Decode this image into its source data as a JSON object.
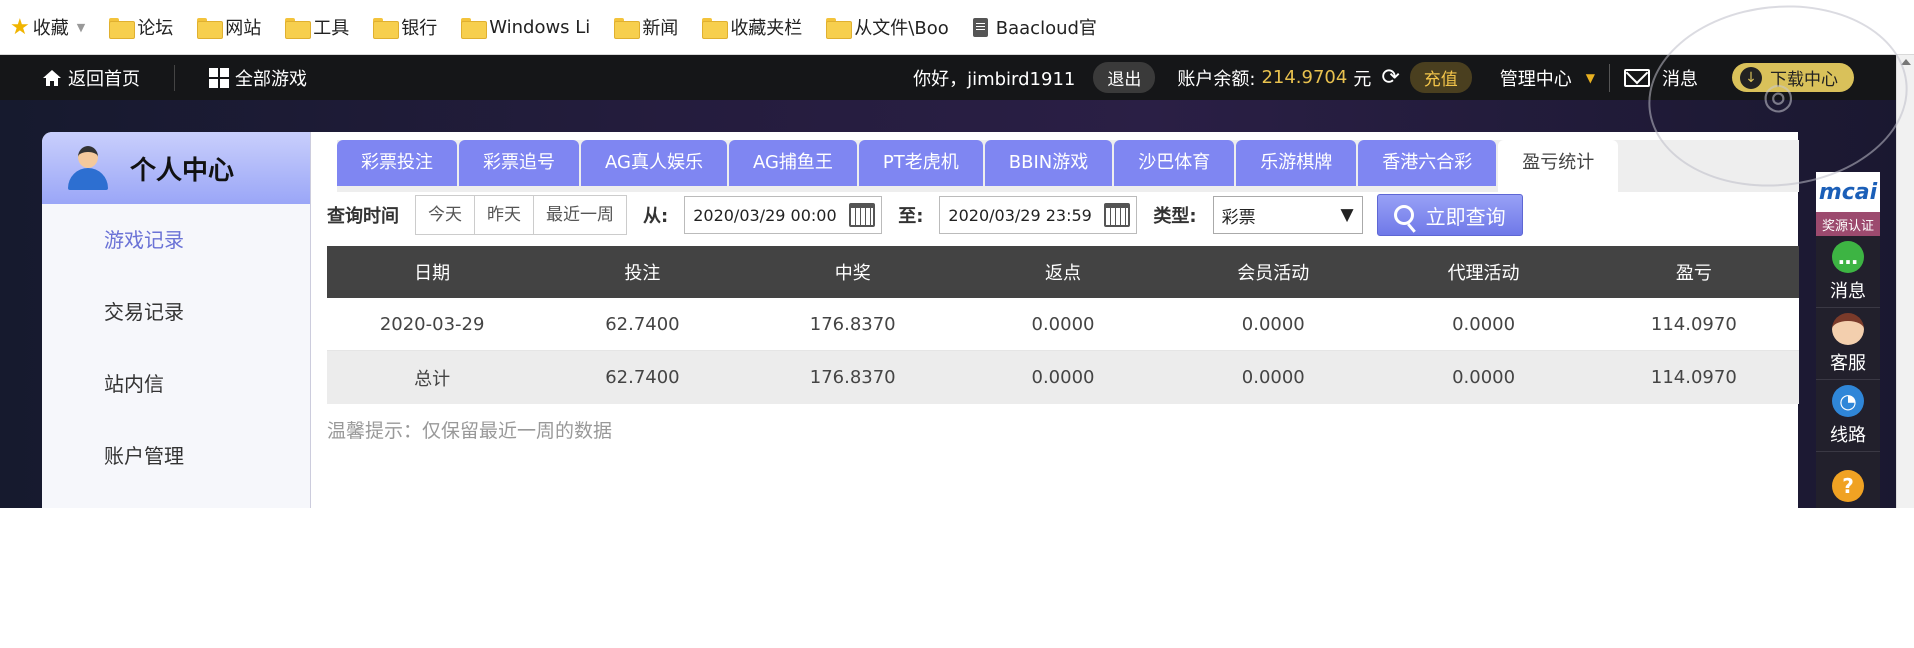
{
  "bookmarks": [
    {
      "label": "收藏",
      "icon": "star-icon"
    },
    {
      "label": "论坛",
      "icon": "folder-icon"
    },
    {
      "label": "网站",
      "icon": "folder-icon"
    },
    {
      "label": "工具",
      "icon": "folder-icon"
    },
    {
      "label": "银行",
      "icon": "folder-icon"
    },
    {
      "label": "Windows Li",
      "icon": "folder-icon"
    },
    {
      "label": "新闻",
      "icon": "folder-icon"
    },
    {
      "label": "收藏夹栏",
      "icon": "folder-icon"
    },
    {
      "label": "从文件\\Boo",
      "icon": "folder-icon"
    },
    {
      "label": "Baacloud官",
      "icon": "document-icon"
    }
  ],
  "topnav": {
    "home": "返回首页",
    "all_games": "全部游戏",
    "greeting": "你好，jimbird1911",
    "logout": "退出",
    "balance_label": "账户余额:",
    "balance_value": "214.9704",
    "balance_unit": "元",
    "recharge": "充值",
    "management": "管理中心",
    "messages": "消息",
    "download": "下载中心",
    "balance_color": "#e8c14e"
  },
  "sidebar": {
    "title": "个人中心",
    "items": [
      {
        "label": "游戏记录"
      },
      {
        "label": "交易记录"
      },
      {
        "label": "站内信"
      },
      {
        "label": "账户管理"
      }
    ],
    "accent": "#6a72d6"
  },
  "tabs": [
    {
      "label": "彩票投注"
    },
    {
      "label": "彩票追号"
    },
    {
      "label": "AG真人娱乐"
    },
    {
      "label": "AG捕鱼王"
    },
    {
      "label": "PT老虎机"
    },
    {
      "label": "BBIN游戏"
    },
    {
      "label": "沙巴体育"
    },
    {
      "label": "乐游棋牌"
    },
    {
      "label": "香港六合彩"
    },
    {
      "label": "盈亏统计"
    }
  ],
  "query": {
    "time_label": "查询时间",
    "quick": [
      "今天",
      "昨天",
      "最近一周"
    ],
    "from_label": "从:",
    "from_value": "2020/03/29 00:00",
    "to_label": "至:",
    "to_value": "2020/03/29 23:59",
    "type_label": "类型:",
    "type_value": "彩票",
    "submit": "立即查询"
  },
  "table": {
    "headers": [
      "日期",
      "投注",
      "中奖",
      "返点",
      "会员活动",
      "代理活动",
      "盈亏"
    ],
    "rows": [
      [
        "2020-03-29",
        "62.7400",
        "176.8370",
        "0.0000",
        "0.0000",
        "0.0000",
        "114.0970"
      ],
      [
        "总计",
        "62.7400",
        "176.8370",
        "0.0000",
        "0.0000",
        "0.0000",
        "114.0970"
      ]
    ]
  },
  "tip": "温馨提示：仅保留最近一周的数据",
  "floatbar": {
    "logo": "mcai",
    "cert": "奖源认证",
    "items": [
      {
        "label": "消息"
      },
      {
        "label": "客服"
      },
      {
        "label": "线路"
      }
    ]
  }
}
